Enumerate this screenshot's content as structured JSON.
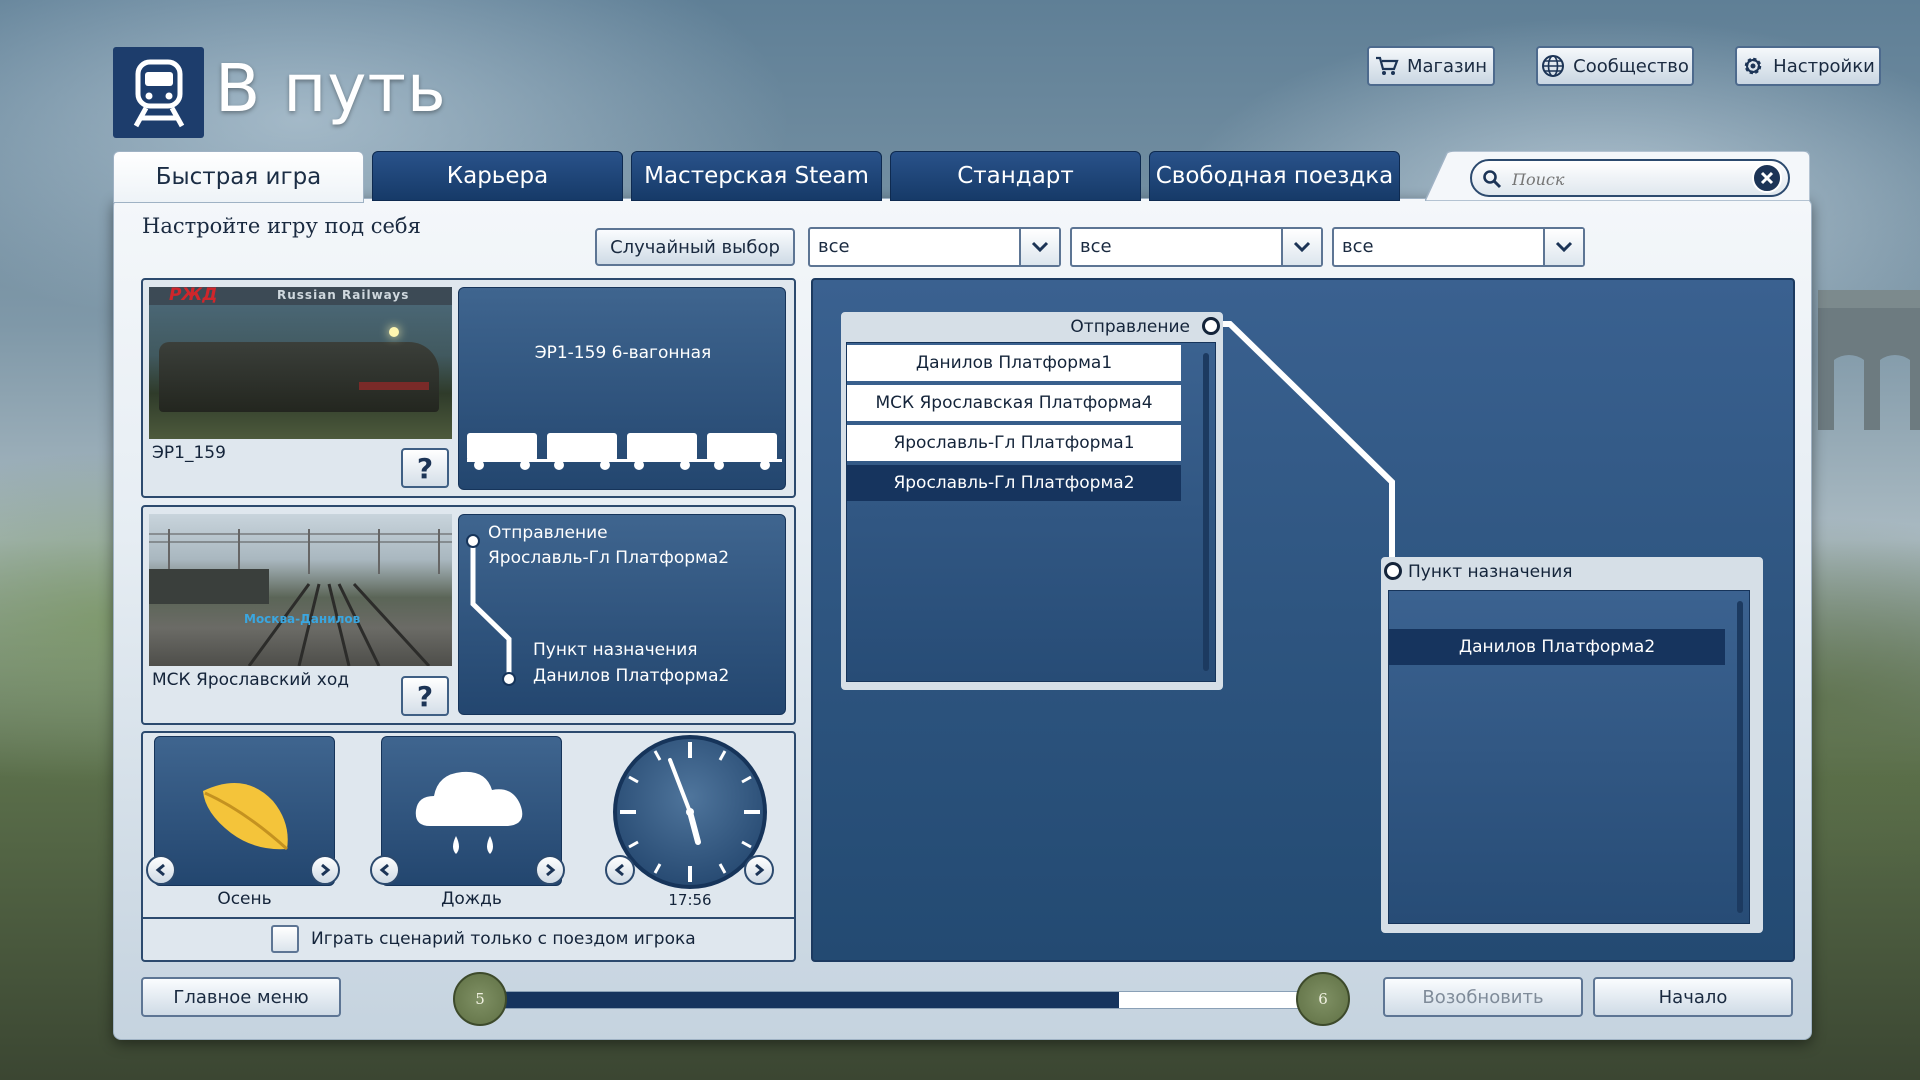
{
  "header": {
    "title": "В путь",
    "store_label": "Магазин",
    "community_label": "Сообщество",
    "settings_label": "Настройки"
  },
  "tabs": [
    {
      "label": "Быстрая игра",
      "active": true
    },
    {
      "label": "Карьера",
      "active": false
    },
    {
      "label": "Мастерская Steam",
      "active": false
    },
    {
      "label": "Стандарт",
      "active": false
    },
    {
      "label": "Свободная поездка",
      "active": false
    }
  ],
  "search": {
    "placeholder": "Поиск"
  },
  "subtitle": "Настройте игру под себя",
  "filters": {
    "random_label": "Случайный выбор",
    "select1": "все",
    "select2": "все",
    "select3": "все"
  },
  "train": {
    "name": "ЭР1_159",
    "consist": "ЭР1-159 6-вагонная",
    "banner": "Russian Railways",
    "logo_text": "РЖД"
  },
  "route": {
    "name": "МСК Ярославский ход",
    "overlay": "Москва-Данилов",
    "departure_label": "Отправление",
    "departure_value": "Ярославль-Гл Платформа2",
    "destination_label": "Пункт назначения",
    "destination_value": "Данилов Платформа2"
  },
  "conditions": {
    "season": "Осень",
    "weather": "Дождь",
    "time": "17:56"
  },
  "player_only_label": "Играть сценарий только с поездом игрока",
  "departure_list": {
    "title": "Отправление",
    "items": [
      "Данилов Платформа1",
      "МСК Ярославская Платформа4",
      "Ярославль-Гл Платформа1",
      "Ярославль-Гл Платформа2"
    ],
    "selected_index": 3
  },
  "destination_list": {
    "title": "Пункт назначения",
    "items": [
      "Данилов Платформа2"
    ],
    "selected_index": 0
  },
  "footer": {
    "main_menu_label": "Главное меню",
    "progress_start": "5",
    "progress_end": "6",
    "progress_fraction": 0.78,
    "resume_label": "Возобновить",
    "start_label": "Начало"
  },
  "colors": {
    "tab_blue": "#1d3d6c",
    "panel_blue": "#2e5580",
    "selected_row": "#16345e",
    "leaf": "#f4c43a"
  }
}
